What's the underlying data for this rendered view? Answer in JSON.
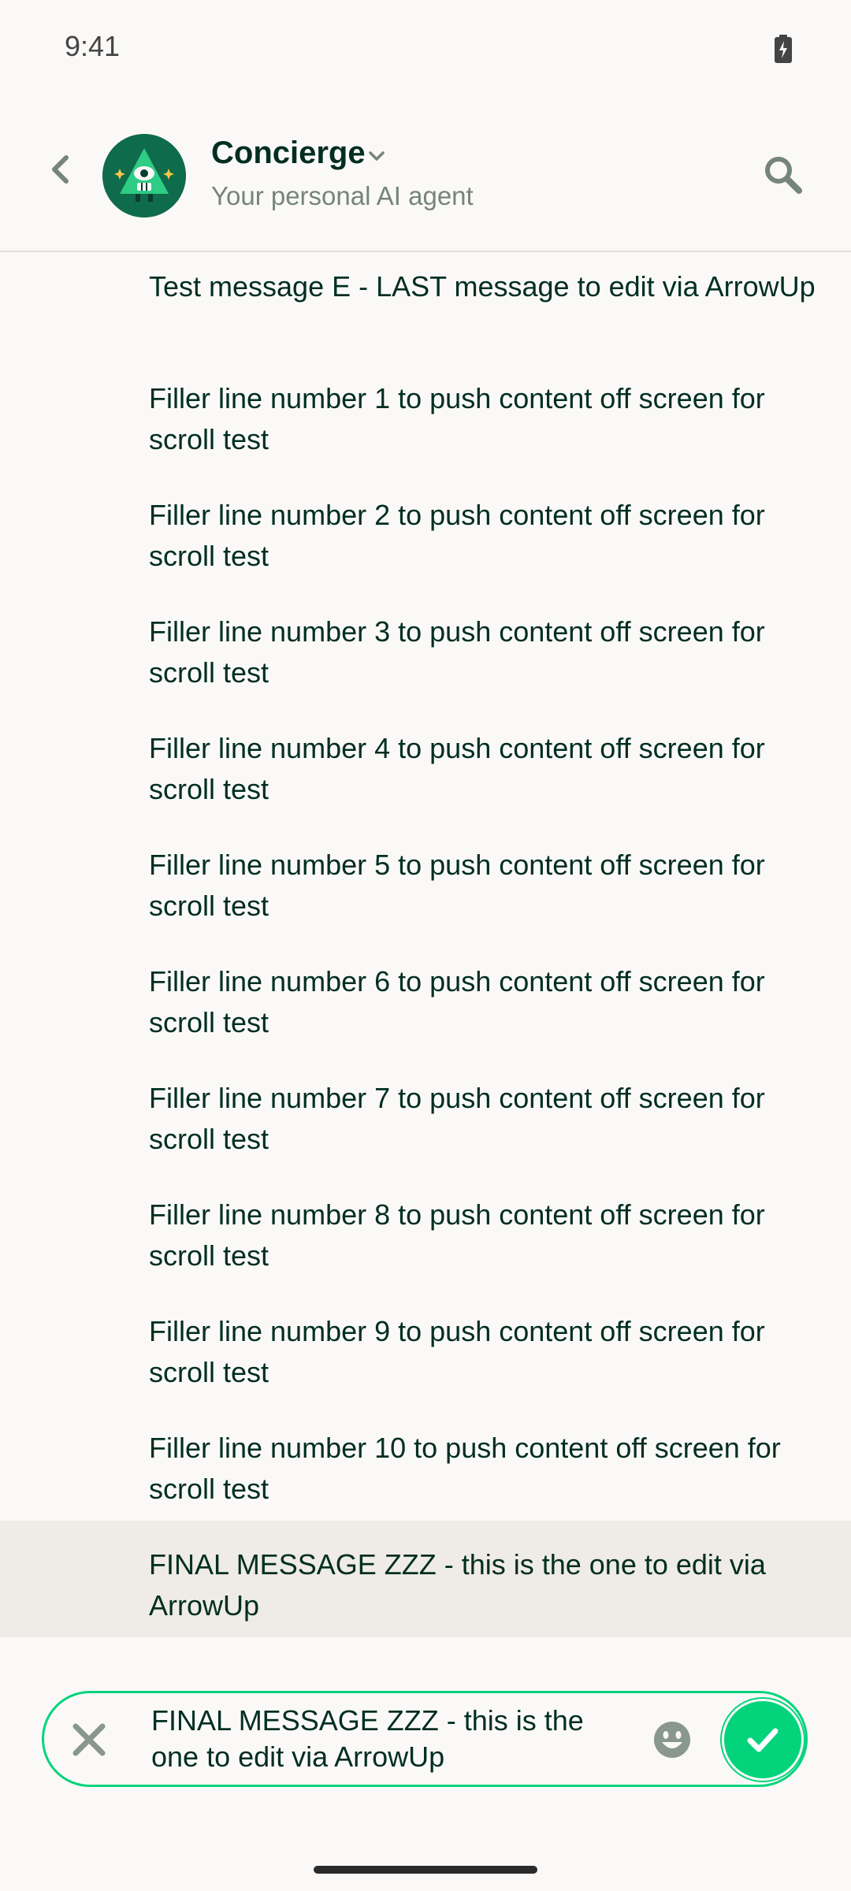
{
  "status_bar": {
    "time": "9:41",
    "battery_icon": "battery-charging-icon"
  },
  "header": {
    "back_icon": "chevron-left-icon",
    "avatar_icon": "concierge-avatar-icon",
    "title": "Concierge",
    "title_dropdown_icon": "chevron-down-icon",
    "subtitle": "Your personal AI agent",
    "search_icon": "search-icon"
  },
  "messages": [
    {
      "text": "Test message E - LAST message to edit via ArrowUp"
    },
    {
      "text": "Filler line number 1 to push content off screen for scroll test"
    },
    {
      "text": "Filler line number 2 to push content off screen for scroll test"
    },
    {
      "text": "Filler line number 3 to push content off screen for scroll test"
    },
    {
      "text": "Filler line number 4 to push content off screen for scroll test"
    },
    {
      "text": "Filler line number 5 to push content off screen for scroll test"
    },
    {
      "text": "Filler line number 6 to push content off screen for scroll test"
    },
    {
      "text": "Filler line number 7 to push content off screen for scroll test"
    },
    {
      "text": "Filler line number 8 to push content off screen for scroll test"
    },
    {
      "text": "Filler line number 9 to push content off screen for scroll test"
    },
    {
      "text": "Filler line number 10 to push content off screen for scroll test"
    },
    {
      "text": "FINAL MESSAGE ZZZ - this is the one to edit via ArrowUp",
      "highlighted": true
    }
  ],
  "composer": {
    "value": "FINAL MESSAGE ZZZ - this is the one to edit via ArrowUp",
    "cancel_icon": "close-icon",
    "emoji_icon": "emoji-icon",
    "save_icon": "checkmark-icon"
  },
  "colors": {
    "background": "#FBF9F7",
    "text": "#002E22",
    "muted": "#76847E",
    "accent": "#03D47C",
    "highlight": "#EFEBE6"
  }
}
